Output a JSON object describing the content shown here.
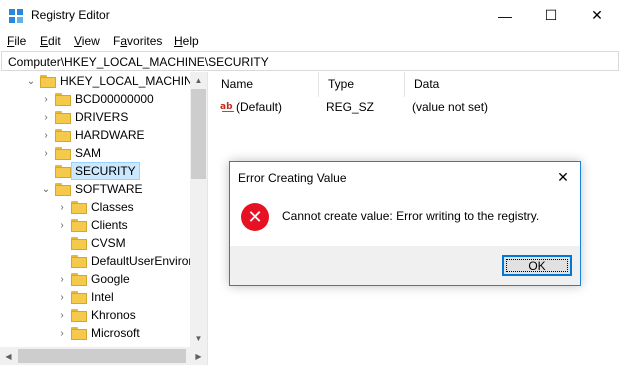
{
  "window": {
    "title": "Registry Editor",
    "minimize_glyph": "—",
    "maximize_glyph": "☐",
    "close_glyph": "✕"
  },
  "menu": [
    {
      "label": "File",
      "underline": "F",
      "rest": "ile"
    },
    {
      "label": "Edit",
      "underline": "E",
      "rest": "dit"
    },
    {
      "label": "View",
      "underline": "V",
      "rest": "iew"
    },
    {
      "label": "Favorites",
      "underline": "a",
      "prefix": "F",
      "rest": "vorites"
    },
    {
      "label": "Help",
      "underline": "H",
      "rest": "elp"
    }
  ],
  "address": {
    "path": "Computer\\HKEY_LOCAL_MACHINE\\SECURITY"
  },
  "tree": {
    "items": [
      {
        "label": "HKEY_LOCAL_MACHINE",
        "expanded": true,
        "level": 0
      },
      {
        "label": "BCD00000000",
        "expanded": false,
        "level": 1
      },
      {
        "label": "DRIVERS",
        "expanded": false,
        "level": 1
      },
      {
        "label": "HARDWARE",
        "expanded": false,
        "level": 1
      },
      {
        "label": "SAM",
        "expanded": false,
        "level": 1
      },
      {
        "label": "SECURITY",
        "expanded": false,
        "level": 1,
        "selected": true
      },
      {
        "label": "SOFTWARE",
        "expanded": true,
        "level": 1
      },
      {
        "label": "Classes",
        "expanded": false,
        "level": 2
      },
      {
        "label": "Clients",
        "expanded": false,
        "level": 2
      },
      {
        "label": "CVSM",
        "expanded": false,
        "level": 2
      },
      {
        "label": "DefaultUserEnviror",
        "expanded": false,
        "level": 2
      },
      {
        "label": "Google",
        "expanded": false,
        "level": 2
      },
      {
        "label": "Intel",
        "expanded": false,
        "level": 2
      },
      {
        "label": "Khronos",
        "expanded": false,
        "level": 2
      },
      {
        "label": "Microsoft",
        "expanded": false,
        "level": 2
      }
    ]
  },
  "values": {
    "columns": [
      "Name",
      "Type",
      "Data"
    ],
    "rows": [
      {
        "name": "(Default)",
        "type": "REG_SZ",
        "data": "(value not set)",
        "icon": "string-value-icon"
      }
    ]
  },
  "dialog": {
    "title": "Error Creating Value",
    "message": "Cannot create value: Error writing to the registry.",
    "ok_label": "OK",
    "icon": "error-icon",
    "close_glyph": "✕"
  },
  "colors": {
    "selection_bg": "#cce8ff",
    "selection_border": "#99d1ff",
    "folder": "#f5c94b",
    "error_red": "#e81123",
    "dialog_border": "#1883d7",
    "focus_blue": "#0078d7"
  }
}
